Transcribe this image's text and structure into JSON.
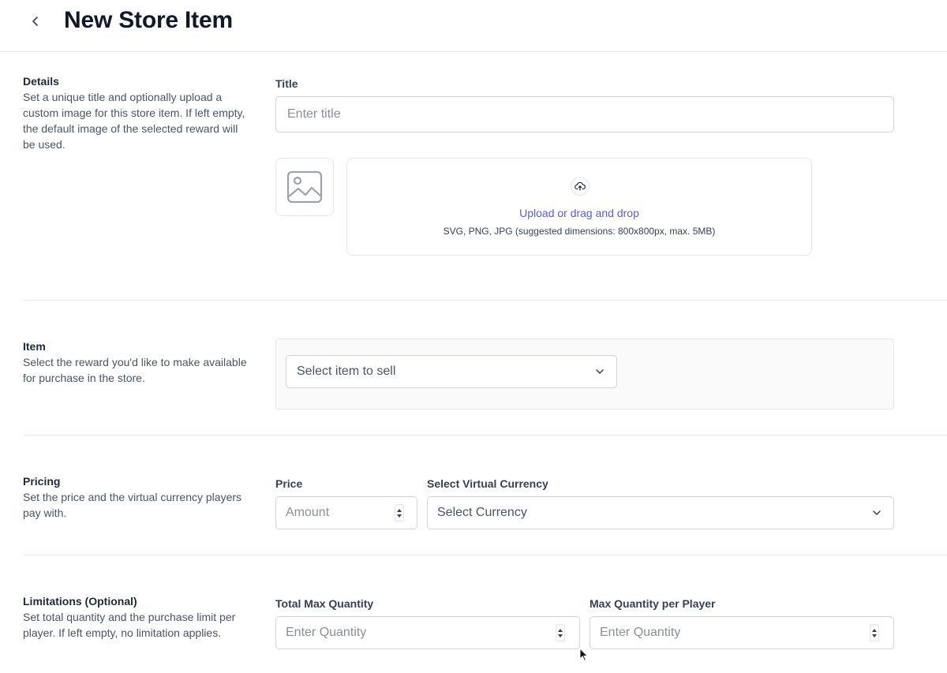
{
  "header": {
    "title": "New Store Item",
    "back_icon": "chevron-left-icon"
  },
  "details": {
    "title": "Details",
    "description": "Set a unique title and optionally upload a custom image for this store item. If left empty, the default image of the selected reward will be used.",
    "title_label": "Title",
    "title_placeholder": "Enter title",
    "upload_link": "Upload or drag and drop",
    "upload_hint": "SVG, PNG, JPG (suggested dimensions: 800x800px, max. 5MB)"
  },
  "item": {
    "title": "Item",
    "description": "Select the reward you'd like to make available for purchase in the store.",
    "select_placeholder": "Select item to sell"
  },
  "pricing": {
    "title": "Pricing",
    "description": "Set the price and the virtual currency players pay with.",
    "price_label": "Price",
    "price_placeholder": "Amount",
    "currency_label": "Select Virtual Currency",
    "currency_placeholder": "Select Currency"
  },
  "limitations": {
    "title": "Limitations (Optional)",
    "description": "Set total quantity and the purchase limit per player. If left empty, no limitation applies.",
    "total_label": "Total Max Quantity",
    "total_placeholder": "Enter Quantity",
    "per_player_label": "Max Quantity per Player",
    "per_player_placeholder": "Enter Quantity"
  },
  "colors": {
    "accent": "#5b5fc7",
    "border": "#d1d5db",
    "divider": "#e5e7eb"
  }
}
